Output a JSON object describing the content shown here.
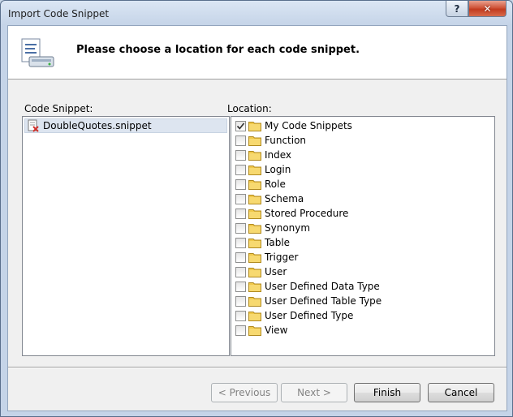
{
  "window": {
    "title": "Import Code Snippet",
    "help_glyph": "?",
    "close_glyph": "✕"
  },
  "header": {
    "instruction": "Please choose a location for each code snippet."
  },
  "snippet_panel": {
    "label": "Code Snippet:",
    "items": [
      {
        "name": "DoubleQuotes.snippet",
        "selected": true,
        "icon": "snippet-file-icon"
      }
    ]
  },
  "location_panel": {
    "label": "Location:",
    "items": [
      {
        "name": "My Code Snippets",
        "checked": true
      },
      {
        "name": "Function",
        "checked": false
      },
      {
        "name": "Index",
        "checked": false
      },
      {
        "name": "Login",
        "checked": false
      },
      {
        "name": "Role",
        "checked": false
      },
      {
        "name": "Schema",
        "checked": false
      },
      {
        "name": "Stored Procedure",
        "checked": false
      },
      {
        "name": "Synonym",
        "checked": false
      },
      {
        "name": "Table",
        "checked": false
      },
      {
        "name": "Trigger",
        "checked": false
      },
      {
        "name": "User",
        "checked": false
      },
      {
        "name": "User Defined Data Type",
        "checked": false
      },
      {
        "name": "User Defined Table Type",
        "checked": false
      },
      {
        "name": "User Defined Type",
        "checked": false
      },
      {
        "name": "View",
        "checked": false
      }
    ]
  },
  "buttons": {
    "previous": {
      "label": "< Previous",
      "enabled": false
    },
    "next": {
      "label": "Next >",
      "enabled": false
    },
    "finish": {
      "label": "Finish",
      "enabled": true
    },
    "cancel": {
      "label": "Cancel",
      "enabled": true
    }
  },
  "colors": {
    "folder": "#f0c84a",
    "selection": "#dde5f0",
    "close_button": "#c23b1f"
  }
}
